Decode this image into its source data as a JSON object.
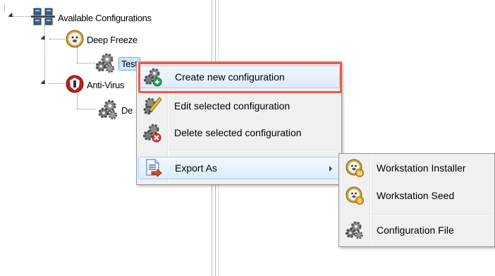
{
  "tree": {
    "root": {
      "label": "Available Configurations",
      "icon": "network-servers-icon"
    },
    "children": [
      {
        "label": "Deep Freeze",
        "icon": "deep-freeze-bear-icon",
        "children": [
          {
            "label": "Test",
            "icon": "gears-icon",
            "selected": true
          }
        ]
      },
      {
        "label": "Anti-Virus",
        "icon": "antivirus-shield-icon",
        "children": [
          {
            "label": "De",
            "icon": "gears-icon"
          }
        ]
      }
    ]
  },
  "context_menu": {
    "items": [
      {
        "label": "Create new configuration",
        "icon": "gears-add-icon",
        "hover": true,
        "highlighted": true
      },
      {
        "label": "Edit selected configuration",
        "icon": "gears-edit-icon"
      },
      {
        "label": "Delete selected configuration",
        "icon": "gears-delete-icon"
      },
      {
        "label": "Export As",
        "icon": "export-document-icon",
        "has_submenu": true,
        "hover": true
      }
    ]
  },
  "submenu": {
    "items": [
      {
        "label": "Workstation Installer",
        "icon": "bear-installer-icon"
      },
      {
        "label": "Workstation Seed",
        "icon": "bear-seed-icon"
      },
      {
        "label": "Configuration File",
        "icon": "gears-icon"
      }
    ]
  },
  "colors": {
    "highlight_border": "#ee5a4a",
    "selection_bg": "#cde6fb",
    "menu_bg": "#f0f0f0"
  }
}
